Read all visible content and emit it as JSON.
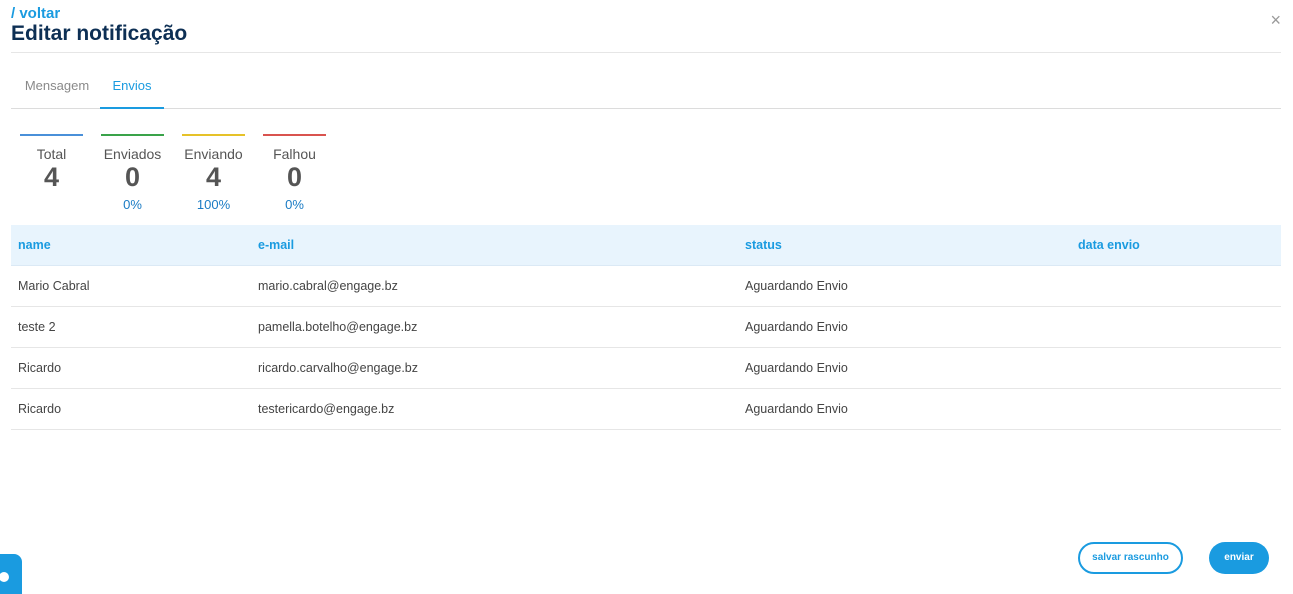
{
  "header": {
    "back_label": "/ voltar",
    "title": "Editar notificação",
    "close_glyph": "×"
  },
  "tabs": [
    {
      "label": "Mensagem",
      "active": false
    },
    {
      "label": "Envios",
      "active": true
    }
  ],
  "stats": [
    {
      "label": "Total",
      "value": "4",
      "percent": "",
      "color": "#4a90d9"
    },
    {
      "label": "Enviados",
      "value": "0",
      "percent": "0%",
      "color": "#3aa34a"
    },
    {
      "label": "Enviando",
      "value": "4",
      "percent": "100%",
      "color": "#e6c229"
    },
    {
      "label": "Falhou",
      "value": "0",
      "percent": "0%",
      "color": "#d9534f"
    }
  ],
  "table": {
    "columns": [
      "name",
      "e-mail",
      "status",
      "data envio"
    ],
    "rows": [
      [
        "Mario Cabral",
        "mario.cabral@engage.bz",
        "Aguardando Envio",
        ""
      ],
      [
        "teste 2",
        "pamella.botelho@engage.bz",
        "Aguardando Envio",
        ""
      ],
      [
        "Ricardo",
        "ricardo.carvalho@engage.bz",
        "Aguardando Envio",
        ""
      ],
      [
        "Ricardo",
        "testericardo@engage.bz",
        "Aguardando Envio",
        ""
      ]
    ]
  },
  "footer": {
    "draft_label": "salvar rascunho",
    "send_label": "enviar"
  },
  "colors": {
    "accent": "#1a9be0",
    "title": "#0d2f54",
    "header_bg": "#e8f4fd"
  },
  "icons": {
    "close": "close-icon",
    "help": "help-chat-icon"
  }
}
